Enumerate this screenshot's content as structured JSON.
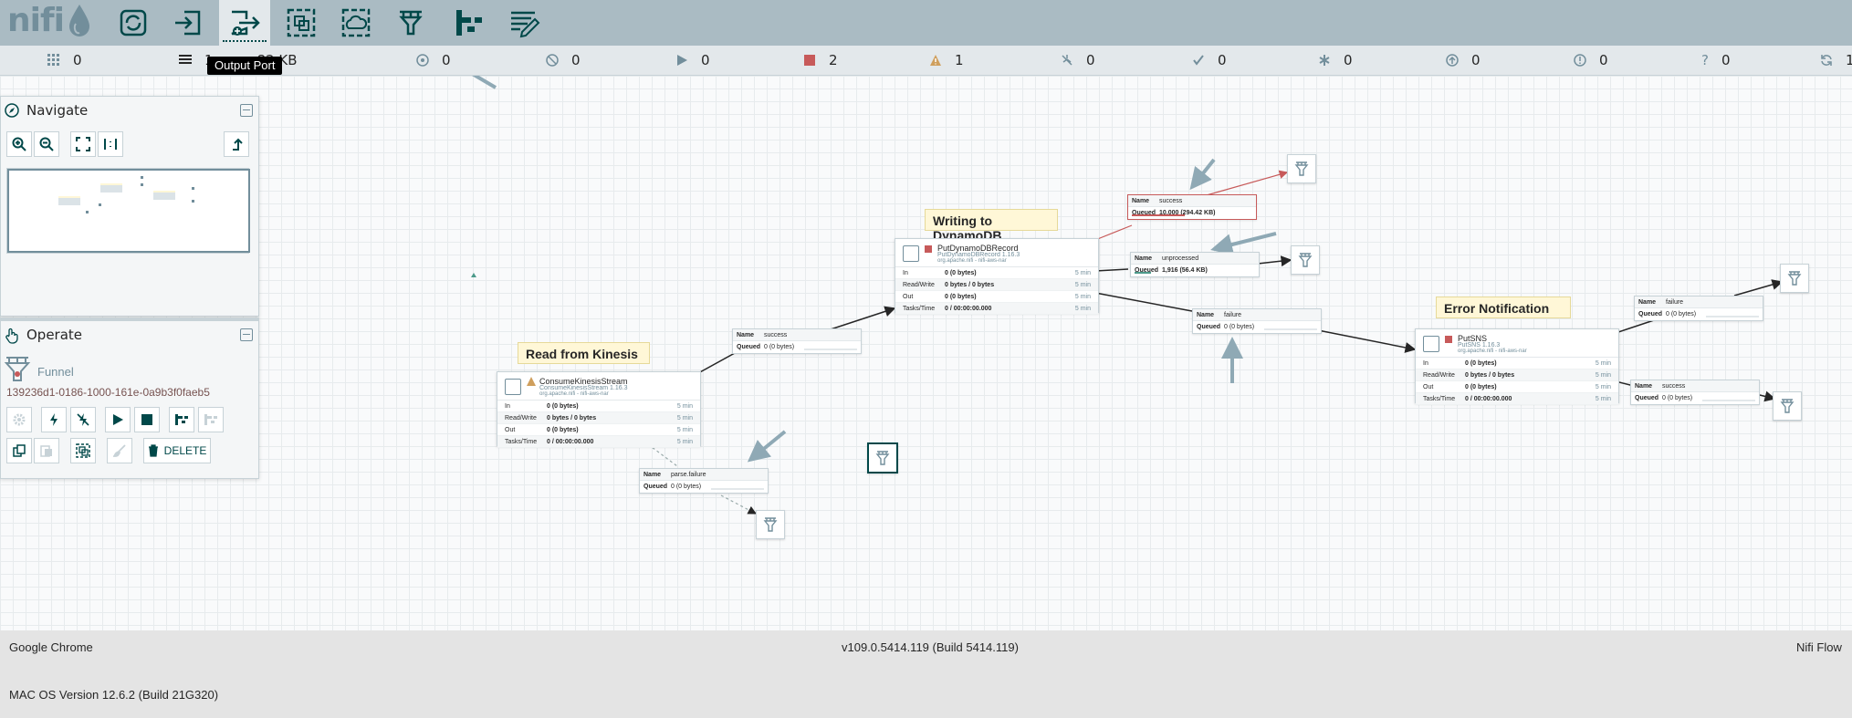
{
  "app": {
    "logo": "nifi"
  },
  "toolbar": {
    "buttons": [
      {
        "name": "processor",
        "icon": "processor-icon"
      },
      {
        "name": "input-port",
        "icon": "input-port-icon"
      },
      {
        "name": "output-port",
        "icon": "output-port-icon",
        "active": true
      },
      {
        "name": "process-group",
        "icon": "process-group-icon"
      },
      {
        "name": "remote-process-group",
        "icon": "remote-process-group-icon"
      },
      {
        "name": "funnel",
        "icon": "funnel-icon"
      },
      {
        "name": "template",
        "icon": "template-icon"
      },
      {
        "name": "label",
        "icon": "label-icon"
      }
    ],
    "tooltip": "Output Port"
  },
  "status": {
    "active_threads": "0",
    "queued": "1",
    "queued_size": "82 KB",
    "transmitting": "0",
    "not_transmitting": "0",
    "running": "0",
    "stopped": "2",
    "invalid": "1",
    "disabled": "0",
    "up_to_date": "0",
    "locally_modified": "0",
    "stale": "0",
    "locally_modified_stale": "0",
    "sync_failure": "0",
    "refresh": "1"
  },
  "navigate": {
    "title": "Navigate"
  },
  "operate": {
    "title": "Operate",
    "selection_type": "Funnel",
    "selection_id": "139236d1-0186-1000-161e-0a9b3f0faeb5",
    "delete_label": "DELETE"
  },
  "labels": {
    "read_kinesis": "Read from Kinesis",
    "write_dynamo": "Writing to DynamoDB",
    "error_notification": "Error Notification"
  },
  "processors": {
    "kinesis": {
      "name": "ConsumeKinesisStream",
      "type": "ConsumeKinesisStream 1.16.3",
      "bundle": "org.apache.nifi - nifi-aws-nar",
      "in": "0 (0 bytes)",
      "rw": "0 bytes / 0 bytes",
      "out": "0 (0 bytes)",
      "tasks": "0 / 00:00:00.000",
      "window": "5 min"
    },
    "dynamo": {
      "name": "PutDynamoDBRecord",
      "type": "PutDynamoDBRecord 1.16.3",
      "bundle": "org.apache.nifi - nifi-aws-nar",
      "in": "0 (0 bytes)",
      "rw": "0 bytes / 0 bytes",
      "out": "0 (0 bytes)",
      "tasks": "0 / 00:00:00.000",
      "window": "5 min"
    },
    "sns": {
      "name": "PutSNS",
      "type": "PutSNS 1.16.3",
      "bundle": "org.apache.nifi - nifi-aws-nar",
      "in": "0 (0 bytes)",
      "rw": "0 bytes / 0 bytes",
      "out": "0 (0 bytes)",
      "tasks": "0 / 00:00:00.000",
      "window": "5 min"
    }
  },
  "row_labels": {
    "in": "In",
    "rw": "Read/Write",
    "out": "Out",
    "tasks": "Tasks/Time"
  },
  "connections": {
    "kinesis_success": {
      "name": "success",
      "queued": "0 (0 bytes)"
    },
    "parse_failure": {
      "name": "parse.failure",
      "queued": "0 (0 bytes)"
    },
    "dynamo_success": {
      "name": "success",
      "queued": "10,000 (294.42 KB)"
    },
    "dynamo_unprocessed": {
      "name": "unprocessed",
      "queued": "1,916 (56.4 KB)"
    },
    "dynamo_failure": {
      "name": "failure",
      "queued": "0 (0 bytes)"
    },
    "sns_failure": {
      "name": "failure",
      "queued": "0 (0 bytes)"
    },
    "sns_success": {
      "name": "success",
      "queued": "0 (0 bytes)"
    }
  },
  "conn_keys": {
    "name": "Name",
    "queued": "Queued"
  },
  "colors": {
    "toolbar": "#aabbc3",
    "accent": "#004849",
    "error": "#c75a5a",
    "warning": "#cf9f5d",
    "label": "#fff7d7"
  },
  "footer": {
    "browser": "Google Chrome",
    "version": "v109.0.5414.119 (Build 5414.119)",
    "app": "Nifi Flow",
    "os": "MAC OS Version 12.6.2 (Build 21G320)"
  }
}
